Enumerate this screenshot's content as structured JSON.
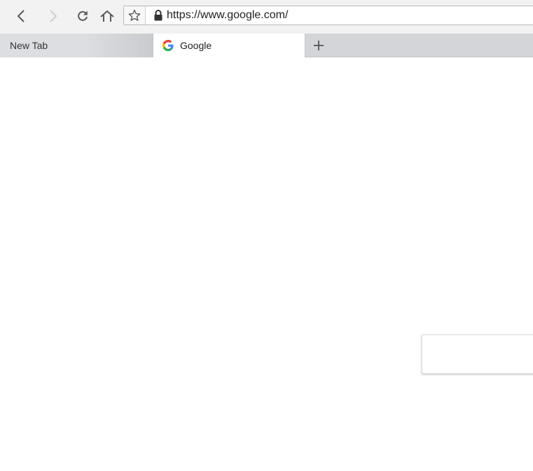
{
  "toolbar": {
    "icons": {
      "back": "chevron-left-icon",
      "forward": "chevron-right-icon",
      "reload": "reload-icon",
      "home": "home-icon",
      "bookmark": "star-icon",
      "lock": "lock-icon"
    },
    "address_bar": {
      "url": "https://www.google.com/"
    }
  },
  "tabs": [
    {
      "label": "New Tab",
      "active": false
    },
    {
      "label": "Google",
      "active": true,
      "favicon": "google-g-icon"
    }
  ],
  "new_tab_icon": "plus-icon",
  "colors": {
    "toolbar_bg": "#f2f2f2",
    "tabstrip_bg": "#d3d5d8",
    "active_tab_bg": "#ffffff",
    "icon_gray": "#5a5a5a",
    "icon_disabled": "#c8c8c8",
    "google_blue": "#4285F4",
    "google_red": "#EA4335",
    "google_yellow": "#FBBC05",
    "google_green": "#34A853"
  }
}
